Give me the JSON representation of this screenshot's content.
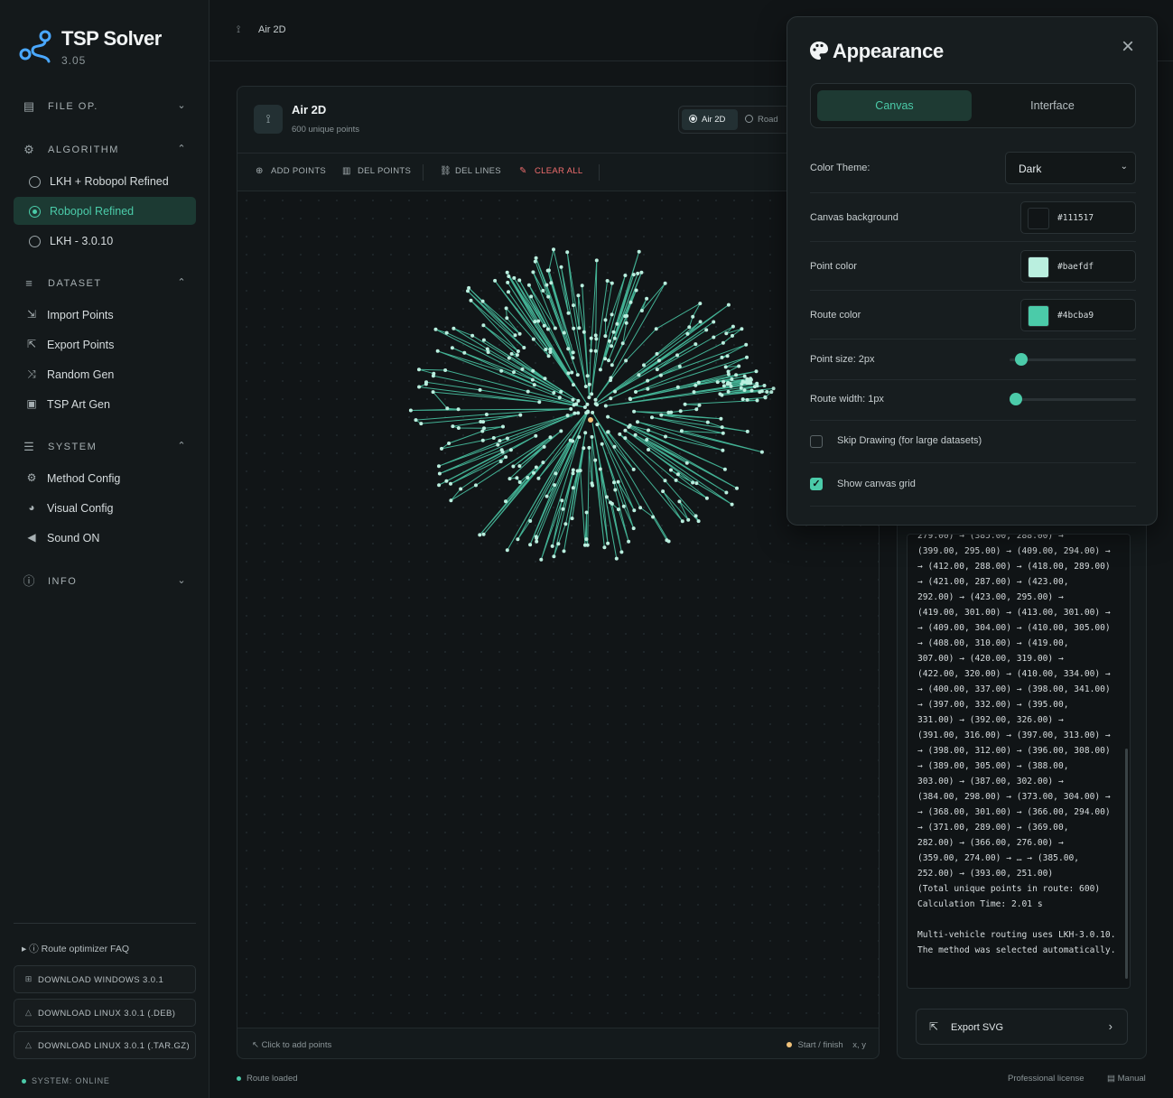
{
  "app": {
    "name": "TSP Solver",
    "version": "3.05"
  },
  "sidebar": {
    "file_op": "FILE OP.",
    "algorithm": {
      "label": "ALGORITHM",
      "items": [
        {
          "label": "LKH + Robopol Refined",
          "selected": false
        },
        {
          "label": "Robopol Refined",
          "selected": true
        },
        {
          "label": "LKH - 3.0.10",
          "selected": false
        }
      ]
    },
    "dataset": {
      "label": "DATASET",
      "items": [
        {
          "label": "Import Points",
          "icon": "file-import-icon"
        },
        {
          "label": "Export Points",
          "icon": "file-export-icon"
        },
        {
          "label": "Random Gen",
          "icon": "shuffle-icon"
        },
        {
          "label": "TSP Art Gen",
          "icon": "image-icon"
        }
      ]
    },
    "system": {
      "label": "SYSTEM",
      "items": [
        {
          "label": "Method Config",
          "icon": "gear-icon"
        },
        {
          "label": "Visual Config",
          "icon": "palette-icon"
        },
        {
          "label": "Sound ON",
          "icon": "speaker-icon"
        }
      ]
    },
    "info": "INFO",
    "faq": "Route optimizer FAQ",
    "downloads": [
      {
        "label": "DOWNLOAD WINDOWS 3.0.1",
        "icon": "windows-icon"
      },
      {
        "label": "DOWNLOAD LINUX 3.0.1 (.DEB)",
        "icon": "linux-icon"
      },
      {
        "label": "DOWNLOAD LINUX 3.0.1 (.TAR.GZ)",
        "icon": "linux-icon"
      }
    ],
    "system_status": "SYSTEM: ONLINE"
  },
  "topbar": {
    "breadcrumb": "Air 2D"
  },
  "panel": {
    "title": "Air 2D",
    "subtitle": "600 unique points",
    "modes": [
      {
        "label": "Air 2D",
        "selected": true
      },
      {
        "label": "Road",
        "selected": false
      }
    ],
    "toolbar": {
      "add_points": "ADD POINTS",
      "del_points": "DEL POINTS",
      "del_lines": "DEL LINES",
      "clear_all": "CLEAR ALL"
    },
    "footer": {
      "hint": "Click to add points",
      "legend_start": "Start / finish",
      "legend_xy": "x, y"
    }
  },
  "log": {
    "text": "279.00) → (385.00, 288.00) →\n(399.00, 295.00) → (409.00, 294.00) →\n→ (412.00, 288.00) → (418.00, 289.00)\n→ (421.00, 287.00) → (423.00,\n292.00) → (423.00, 295.00) →\n(419.00, 301.00) → (413.00, 301.00) →\n→ (409.00, 304.00) → (410.00, 305.00)\n→ (408.00, 310.00) → (419.00,\n307.00) → (420.00, 319.00) →\n(422.00, 320.00) → (410.00, 334.00) →\n→ (400.00, 337.00) → (398.00, 341.00)\n→ (397.00, 332.00) → (395.00,\n331.00) → (392.00, 326.00) →\n(391.00, 316.00) → (397.00, 313.00) →\n→ (398.00, 312.00) → (396.00, 308.00)\n→ (389.00, 305.00) → (388.00,\n303.00) → (387.00, 302.00) →\n(384.00, 298.00) → (373.00, 304.00) →\n→ (368.00, 301.00) → (366.00, 294.00)\n→ (371.00, 289.00) → (369.00,\n282.00) → (366.00, 276.00) →\n(359.00, 274.00) → … → (385.00,\n252.00) → (393.00, 251.00)\n(Total unique points in route: 600)\nCalculation Time: 2.01 s\n\nMulti-vehicle routing uses LKH-3.0.10.\nThe method was selected automatically.",
    "export_label": "Export SVG"
  },
  "statusbar": {
    "route": "Route loaded",
    "license": "Professional license",
    "manual": "Manual"
  },
  "appearance": {
    "title": "Appearance",
    "tabs": [
      {
        "label": "Canvas",
        "selected": true
      },
      {
        "label": "Interface",
        "selected": false
      }
    ],
    "color_theme": {
      "label": "Color Theme:",
      "value": "Dark"
    },
    "canvas_background": {
      "label": "Canvas background",
      "value": "#111517"
    },
    "point_color": {
      "label": "Point color",
      "value": "#baefdf"
    },
    "route_color": {
      "label": "Route color",
      "value": "#4bcba9"
    },
    "point_size": {
      "label": "Point size: 2px",
      "level": 0.05
    },
    "route_width": {
      "label": "Route width: 1px",
      "level": 0.0
    },
    "skip_drawing": {
      "label": "Skip Drawing (for large datasets)",
      "checked": false
    },
    "show_grid": {
      "label": "Show canvas grid",
      "checked": true
    }
  },
  "colors": {
    "accent": "#4bcba9",
    "point": "#baefdf",
    "danger": "#ef6d6d",
    "start": "#f1c27a"
  }
}
